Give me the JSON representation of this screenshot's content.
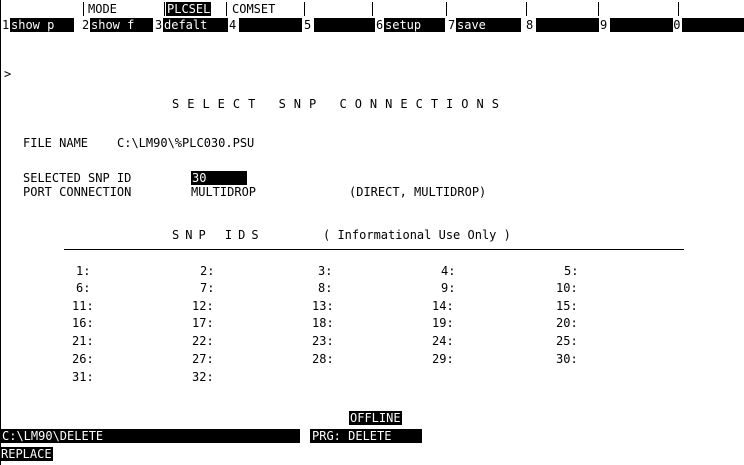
{
  "top_labels": {
    "mode": "MODE",
    "plcsel": "PLCSEL",
    "comset": "COMSET"
  },
  "function_keys": [
    {
      "num": "1",
      "label": "show p"
    },
    {
      "num": "2",
      "label": "show f"
    },
    {
      "num": "3",
      "label": "defalt"
    },
    {
      "num": "4",
      "label": ""
    },
    {
      "num": "5",
      "label": ""
    },
    {
      "num": "6",
      "label": "setup"
    },
    {
      "num": "7",
      "label": "save"
    },
    {
      "num": "8",
      "label": ""
    },
    {
      "num": "9",
      "label": ""
    },
    {
      "num": "10",
      "label": ""
    }
  ],
  "prompt": ">",
  "screen_title": "SELECT SNP CONNECTIONS",
  "file": {
    "label": "FILE NAME",
    "value": "C:\\LM90\\%PLC030.PSU"
  },
  "selected_snp": {
    "label": "SELECTED SNP ID",
    "value": "30"
  },
  "port_connection": {
    "label": "PORT CONNECTION",
    "value": "MULTIDROP",
    "options": "(DIRECT, MULTIDROP)"
  },
  "snp_ids": {
    "title": "SNP IDS",
    "note": "( Informational Use Only )",
    "entries": [
      "1:",
      "2:",
      "3:",
      "4:",
      "5:",
      "6:",
      "7:",
      "8:",
      "9:",
      "10:",
      "11:",
      "12:",
      "13:",
      "14:",
      "15:",
      "16:",
      "17:",
      "18:",
      "19:",
      "20:",
      "21:",
      "22:",
      "23:",
      "24:",
      "25:",
      "26:",
      "27:",
      "28:",
      "29:",
      "30:",
      "31:",
      "32:"
    ]
  },
  "status": {
    "mode": "OFFLINE",
    "path": "C:\\LM90\\DELETE",
    "prg": "PRG: DELETE",
    "edit_mode": "REPLACE"
  }
}
